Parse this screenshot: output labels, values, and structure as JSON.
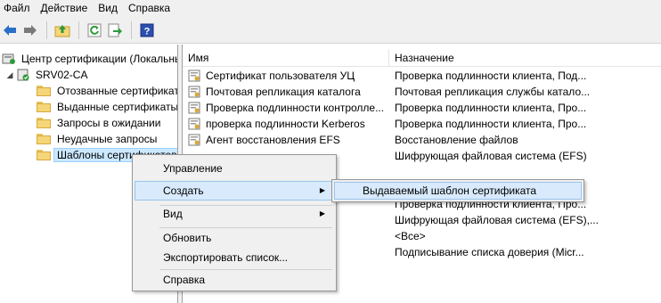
{
  "menubar": {
    "items": [
      "Файл",
      "Действие",
      "Вид",
      "Справка"
    ]
  },
  "toolbar": {
    "icons": [
      "back-arrow-icon",
      "forward-arrow-icon",
      "up-folder-icon",
      "refresh-icon",
      "export-list-icon",
      "help-icon"
    ]
  },
  "tree": {
    "root": "Центр сертификации (Локальный)",
    "ca": "SRV02-CA",
    "items": [
      "Отозванные сертификаты",
      "Выданные сертификаты",
      "Запросы в ожидании",
      "Неудачные запросы",
      "Шаблоны сертификатов"
    ]
  },
  "list": {
    "columns": [
      "Имя",
      "Назначение"
    ],
    "rows": [
      {
        "name": "Сертификат пользователя УЦ",
        "purpose": "Проверка подлинности клиента, Под..."
      },
      {
        "name": "Почтовая репликация каталога",
        "purpose": "Почтовая репликация службы катало..."
      },
      {
        "name": "Проверка подлинности контролле...",
        "purpose": "Проверка подлинности клиента, Про..."
      },
      {
        "name": "проверка подлинности Kerberos",
        "purpose": "Проверка подлинности клиента, Про..."
      },
      {
        "name": "Агент восстановления EFS",
        "purpose": "Восстановление файлов"
      },
      {
        "name": "",
        "purpose": "Шифрующая файловая система (EFS)"
      },
      {
        "name": "",
        "purpose": ""
      },
      {
        "name": "",
        "purpose": ""
      },
      {
        "name": "",
        "purpose": "Проверка подлинности клиента, Про..."
      },
      {
        "name": "",
        "purpose": "Шифрующая файловая система (EFS),..."
      },
      {
        "name": "фикации",
        "purpose": "<Все>"
      },
      {
        "name": "",
        "purpose": "Подписывание списка доверия (Micr..."
      }
    ]
  },
  "context_menu": {
    "manage": "Управление",
    "create": "Создать",
    "view": "Вид",
    "refresh": "Обновить",
    "export": "Экспортировать список...",
    "help": "Справка"
  },
  "submenu": {
    "issued_template": "Выдаваемый шаблон сертификата"
  }
}
